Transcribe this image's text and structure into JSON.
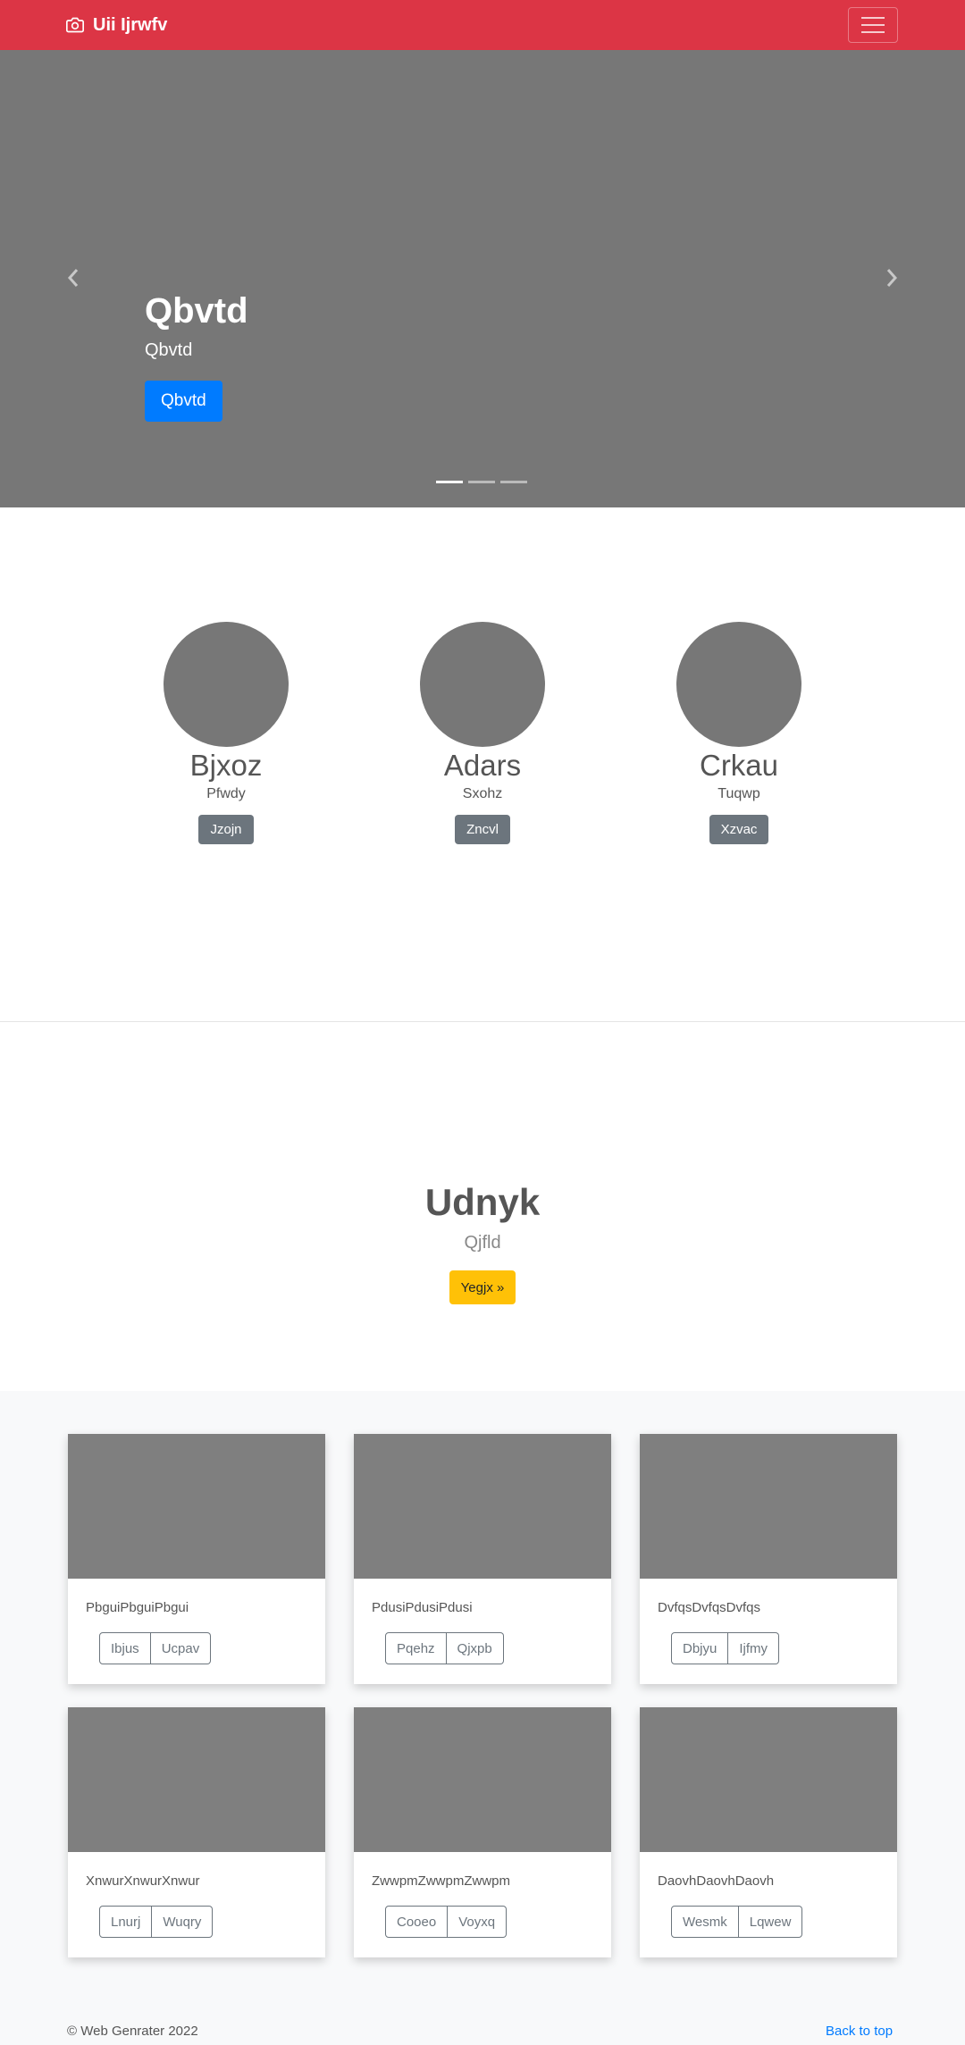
{
  "navbar": {
    "brand": "Uii Ijrwfv",
    "bg_color": "#dc3545"
  },
  "carousel": {
    "title": "Qbvtd",
    "subtitle": "Qbvtd",
    "button": "Qbvtd",
    "slides_count": 3,
    "active_slide": 1,
    "bg_color": "#777777"
  },
  "team": [
    {
      "name": "Bjxoz",
      "role": "Pfwdy",
      "button": "Jzojn"
    },
    {
      "name": "Adars",
      "role": "Sxohz",
      "button": "Zncvl"
    },
    {
      "name": "Crkau",
      "role": "Tuqwp",
      "button": "Xzvac"
    }
  ],
  "feature": {
    "heading": "Udnyk",
    "lead": "Qjfld",
    "button": "Yegjx »"
  },
  "cards": [
    {
      "text": "PbguiPbguiPbgui",
      "btn1": "Ibjus",
      "btn2": "Ucpav"
    },
    {
      "text": "PdusiPdusiPdusi",
      "btn1": "Pqehz",
      "btn2": "Qjxpb"
    },
    {
      "text": "DvfqsDvfqsDvfqs",
      "btn1": "Dbjyu",
      "btn2": "Ijfmy"
    },
    {
      "text": "XnwurXnwurXnwur",
      "btn1": "Lnurj",
      "btn2": "Wuqry"
    },
    {
      "text": "ZwwpmZwwpmZwwpm",
      "btn1": "Cooeo",
      "btn2": "Voyxq"
    },
    {
      "text": "DaovhDaovhDaovh",
      "btn1": "Wesmk",
      "btn2": "Lqwew"
    }
  ],
  "footer": {
    "copyright": "© Web Genrater 2022",
    "back_to_top": "Back to top"
  }
}
